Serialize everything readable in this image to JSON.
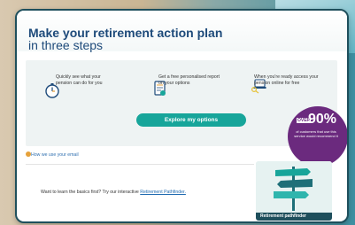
{
  "title": {
    "line1": "Make your retirement action plan",
    "line2": "in three steps"
  },
  "steps": [
    {
      "text": "Quickly see what your pension can do for you",
      "icon": "stopwatch-icon"
    },
    {
      "text": "Get a free personalised report on your options",
      "icon": "document-icon"
    },
    {
      "text": "When you're ready access your pension online for free",
      "icon": "laptop-keys-icon"
    }
  ],
  "cta_label": "Explore my options",
  "badge": {
    "over": "OVER",
    "percent": "90%",
    "caption": "of customers that use this service would recommend it"
  },
  "email_link": "How we use your email",
  "pathfinder": {
    "prompt": "Want to learn the basics first? Try our interactive",
    "link": "Retirement Pathfinder.",
    "tile_label": "Retirement pathfinder"
  },
  "colors": {
    "accent": "#17a59a",
    "title": "#1d4a7a",
    "badge": "#6b2a7e",
    "frame": "#1e4f5c"
  }
}
